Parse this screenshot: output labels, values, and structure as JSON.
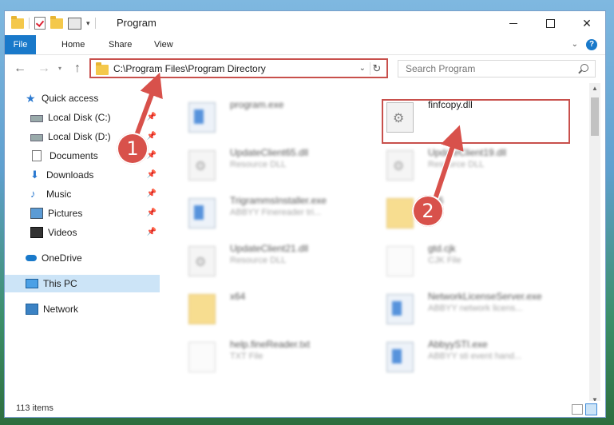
{
  "window": {
    "title": "Program",
    "quick_access_toolbar_dropdown": "▾"
  },
  "ribbon": {
    "tabs": [
      "File",
      "Home",
      "Share",
      "View"
    ]
  },
  "navigation": {
    "back": "←",
    "forward": "→",
    "recent": "▾",
    "up": "↑"
  },
  "address_bar": {
    "path": "C:\\Program Files\\Program Directory",
    "dropdown": "⌄",
    "refresh": "↻"
  },
  "search": {
    "placeholder": "Search Program"
  },
  "nav_pane": {
    "items": [
      {
        "label": "Quick access",
        "icon": "star-icon",
        "pinned": false
      },
      {
        "label": "Local Disk (C:)",
        "icon": "drive-icon",
        "pinned": true
      },
      {
        "label": "Local Disk (D:)",
        "icon": "drive-icon",
        "pinned": true
      },
      {
        "label": "Documents",
        "icon": "documents-icon",
        "pinned": true
      },
      {
        "label": "Downloads",
        "icon": "downloads-icon",
        "pinned": true
      },
      {
        "label": "Music",
        "icon": "music-icon",
        "pinned": true
      },
      {
        "label": "Pictures",
        "icon": "pictures-icon",
        "pinned": true
      },
      {
        "label": "Videos",
        "icon": "videos-icon",
        "pinned": true
      },
      {
        "label": "OneDrive",
        "icon": "onedrive-icon",
        "pinned": false
      },
      {
        "label": "This PC",
        "icon": "this-pc-icon",
        "pinned": false,
        "selected": true
      },
      {
        "label": "Network",
        "icon": "network-icon",
        "pinned": false
      }
    ]
  },
  "files": [
    {
      "name": "program.exe",
      "type": "",
      "icon": "program-icon",
      "blurred": true
    },
    {
      "name": "finfcopy.dll",
      "type": "",
      "icon": "dll-icon",
      "blurred": false,
      "highlighted": true
    },
    {
      "name": "UpdateClient65.dll",
      "type": "Resource DLL",
      "icon": "dll-icon",
      "blurred": true
    },
    {
      "name": "UpdateClient19.dll",
      "type": "Resource DLL",
      "icon": "dll-icon",
      "blurred": true
    },
    {
      "name": "TrigrammsInstaller.exe",
      "type": "ABBYY Finereader tri...",
      "icon": "exe-icon",
      "blurred": true
    },
    {
      "name": "x86",
      "type": "",
      "icon": "folder-icon",
      "blurred": true
    },
    {
      "name": "UpdateClient21.dll",
      "type": "Resource DLL",
      "icon": "dll-icon",
      "blurred": true
    },
    {
      "name": "gtd.cjk",
      "type": "CJK File",
      "icon": "text-file-icon",
      "blurred": true
    },
    {
      "name": "x64",
      "type": "",
      "icon": "folder-icon",
      "blurred": true
    },
    {
      "name": "NetworkLicenseServer.exe",
      "type": "ABBYY network licens...",
      "icon": "exe-icon",
      "blurred": true
    },
    {
      "name": "help.fineReader.txt",
      "type": "TXT File",
      "icon": "text-file-icon",
      "blurred": true
    },
    {
      "name": "AbbyySTI.exe",
      "type": "ABBYY sti event hand...",
      "icon": "exe-icon",
      "blurred": true
    }
  ],
  "status_bar": {
    "item_count": "113 items"
  },
  "callouts": [
    {
      "number": "1"
    },
    {
      "number": "2"
    }
  ],
  "colors": {
    "accent": "#1979ca",
    "callout": "#d8514b",
    "selection": "#cce4f7"
  }
}
